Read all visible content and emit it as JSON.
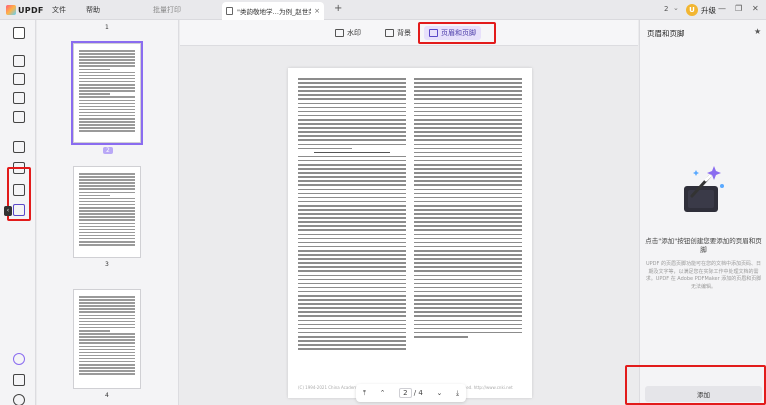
{
  "app": {
    "logo": "UPDF"
  },
  "menu": {
    "file": "文件",
    "help": "帮助",
    "batch_print": "批量打印"
  },
  "tab": {
    "title": "\"类韵敬地学…为例_赵世荣",
    "close": "×",
    "new": "+"
  },
  "titlebar": {
    "count": "2",
    "upgrade_label": "升级",
    "upgrade_initial": "U"
  },
  "toolbar": {
    "watermark": "水印",
    "background": "背景",
    "header_footer": "页眉和页脚"
  },
  "thumbnails": {
    "pages": [
      {
        "number": "2",
        "selected": true
      },
      {
        "number": "3",
        "selected": false
      },
      {
        "number": "4",
        "selected": false
      }
    ],
    "top_number": "1"
  },
  "document": {
    "footer": "(C) 1994-2021 China Academic Journal Electronic Publishing House. All rights reserved.  http://www.cnki.net"
  },
  "pager": {
    "current": "2",
    "separator": "/",
    "total": "4"
  },
  "right_panel": {
    "title": "页眉和页脚",
    "empty_message": "点击\"添加\"按钮创建您要添加的页眉和页脚",
    "description": "UPDF 的页眉页脚功能可在您的文档中添加页码、日期及文字等，以满足您在实际工作中处理文档的需求。UPDF 在 Adobe PDFMaker 添加的页眉和页脚无法编辑。",
    "add_button": "添加"
  },
  "colors": {
    "accent": "#8a6cf0",
    "highlight": "#e21b1b"
  }
}
